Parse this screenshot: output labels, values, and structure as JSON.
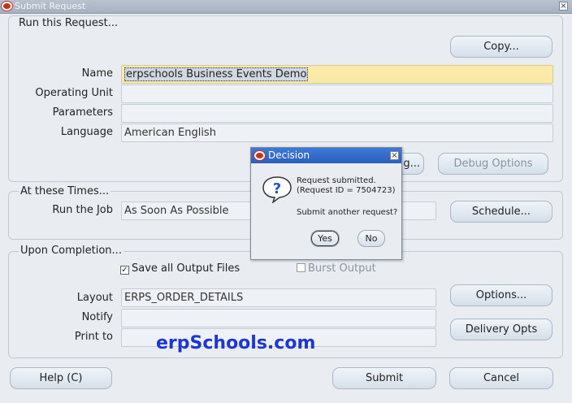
{
  "window": {
    "title": "Submit Request"
  },
  "run_request": {
    "title": "Run this Request...",
    "copy_label": "Copy...",
    "name_label": "Name",
    "name_value": "erpschools Business Events Demo",
    "operating_unit_label": "Operating Unit",
    "operating_unit_value": "",
    "parameters_label": "Parameters",
    "parameters_value": "",
    "language_label": "Language",
    "language_value": "American English",
    "languages_button_partial": "g...",
    "debug_options_label": "Debug Options"
  },
  "times": {
    "title": "At these Times...",
    "run_job_label": "Run the Job",
    "run_job_value": "As Soon As Possible",
    "schedule_label": "Schedule..."
  },
  "completion": {
    "title": "Upon Completion...",
    "save_output_label": "Save all Output Files",
    "save_output_checked": true,
    "burst_output_label": "Burst Output",
    "burst_output_checked": false,
    "layout_label": "Layout",
    "layout_value": "ERPS_ORDER_DETAILS",
    "notify_label": "Notify",
    "notify_value": "",
    "print_to_label": "Print to",
    "print_to_value": "",
    "options_label": "Options...",
    "delivery_label": "Delivery Opts"
  },
  "footer": {
    "help_label": "Help (C)",
    "submit_label": "Submit",
    "cancel_label": "Cancel"
  },
  "dialog": {
    "title": "Decision",
    "line1": "Request submitted.",
    "line2": "(Request ID = 7504723)",
    "line3": "Submit another request?",
    "yes_label": "Yes",
    "no_label": "No"
  },
  "watermark": {
    "text": "erpSchools.com"
  },
  "colors": {
    "active_field": "#fbe9a8",
    "dialog_title": "#2b5fbd",
    "oracle_red": "#c7311f",
    "watermark": "#1c37d6"
  }
}
